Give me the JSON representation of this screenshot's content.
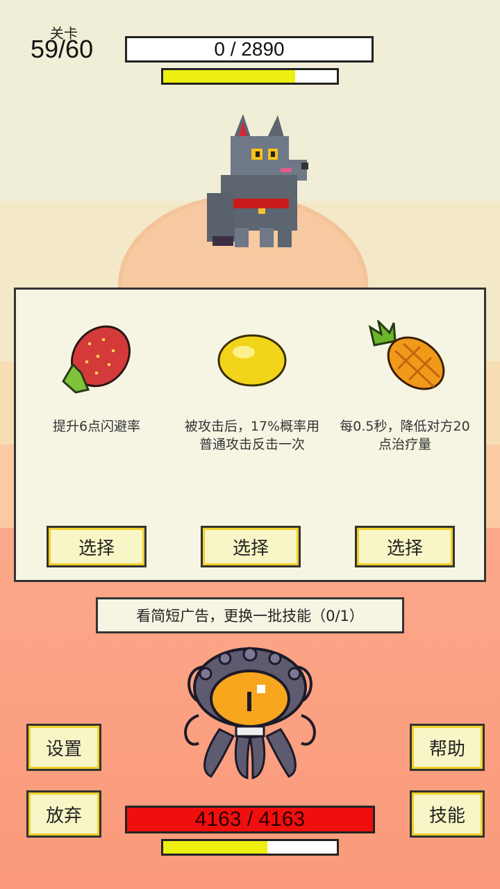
{
  "level": {
    "label": "关卡",
    "value": "59/60"
  },
  "enemy": {
    "hp_text": "0 / 2890",
    "charge_fraction": 0.76
  },
  "skills": [
    {
      "name": "strawberry",
      "description": "提升6点闪避率",
      "button": "选择"
    },
    {
      "name": "lemon",
      "description": "被攻击后，17%概率用普通攻击反击一次",
      "button": "选择"
    },
    {
      "name": "pineapple",
      "description": "每0.5秒，降低对方20点治疗量",
      "button": "选择"
    }
  ],
  "ad_button": "看简短广告，更换一批技能（0/1）",
  "menu": {
    "settings": "设置",
    "help": "帮助",
    "give_up": "放弃",
    "skills": "技能"
  },
  "player": {
    "hp_text": "4163 / 4163",
    "charge_fraction": 0.6
  },
  "colors": {
    "hp_red": "#f00f0f",
    "charge_yellow": "#ecef10",
    "panel_bg": "#f6f5e4",
    "button_bg": "#f8f6c6"
  }
}
